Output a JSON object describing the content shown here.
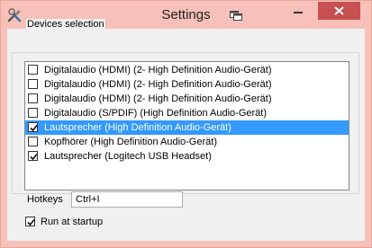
{
  "window": {
    "title": "Settings",
    "accent_color": "#f7c0b8",
    "close_color": "#c75050"
  },
  "icons": {
    "app": "tools-icon",
    "extra": "restore-window-icon",
    "minimize": "minimize-icon",
    "maximize": "maximize-icon",
    "close": "close-icon"
  },
  "devices": {
    "group_label": "Devices selection",
    "items": [
      {
        "label": "Digitalaudio (HDMI) (2- High Definition Audio-Gerät)",
        "checked": false,
        "selected": false
      },
      {
        "label": "Digitalaudio (HDMI) (2- High Definition Audio-Gerät)",
        "checked": false,
        "selected": false
      },
      {
        "label": "Digitalaudio (HDMI) (2- High Definition Audio-Gerät)",
        "checked": false,
        "selected": false
      },
      {
        "label": "Digitalaudio (S/PDIF) (High Definition Audio-Gerät)",
        "checked": false,
        "selected": false
      },
      {
        "label": "Lautsprecher (High Definition Audio-Gerät)",
        "checked": true,
        "selected": true
      },
      {
        "label": "Kopfhörer (High Definition Audio-Gerät)",
        "checked": false,
        "selected": false
      },
      {
        "label": "Lautsprecher (Logitech USB Headset)",
        "checked": true,
        "selected": false
      }
    ]
  },
  "hotkeys": {
    "label": "Hotkeys",
    "value": "Ctrl+I"
  },
  "startup": {
    "label": "Run at startup",
    "checked": true
  }
}
